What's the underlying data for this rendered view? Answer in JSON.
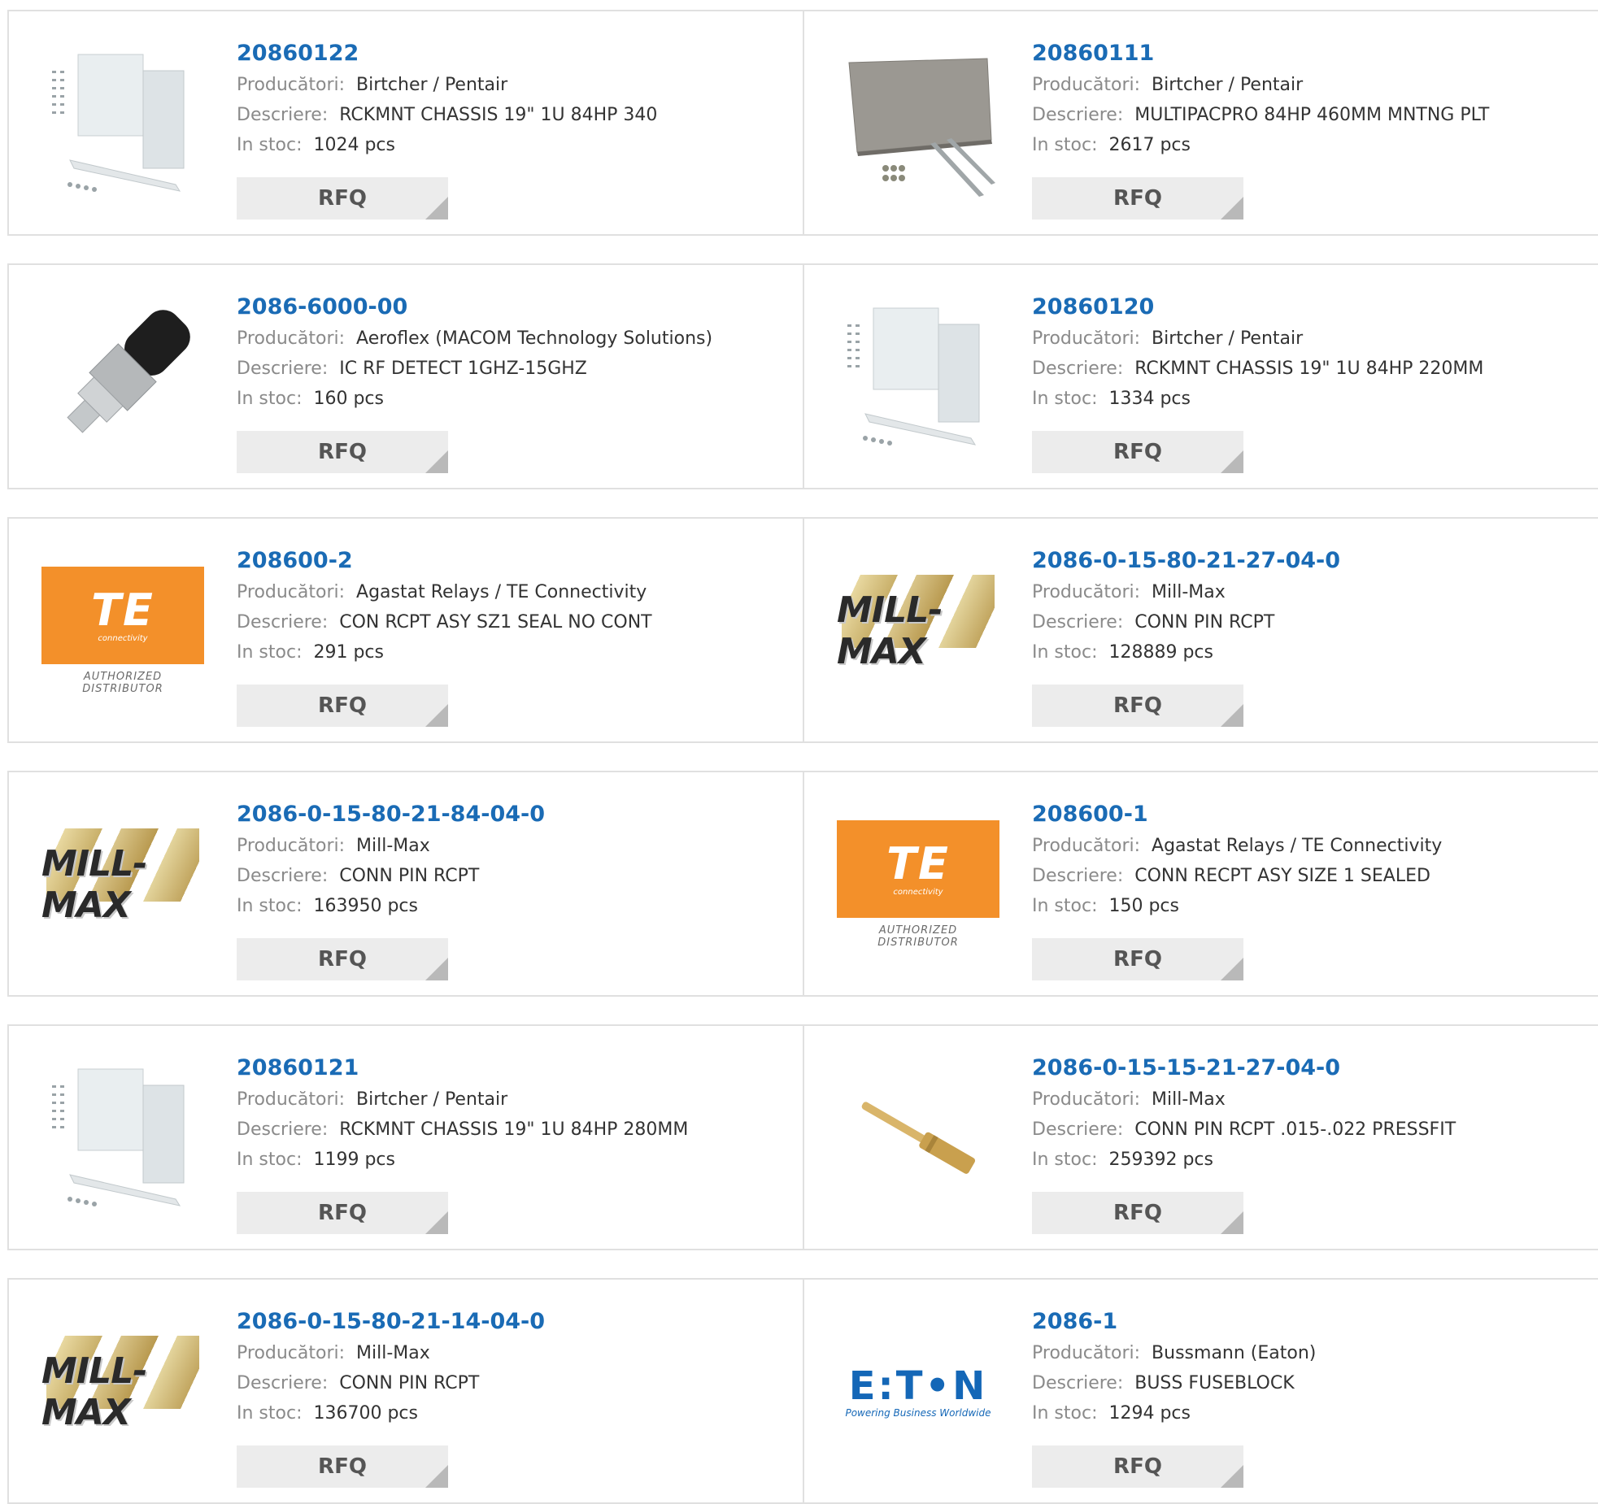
{
  "labels": {
    "manufacturer": "Producători:",
    "description": "Descriere:",
    "stock": "In stoc:",
    "rfq": "RFQ"
  },
  "products": [
    {
      "pn": "20860122",
      "mfr": "Birtcher / Pentair",
      "desc": "RCKMNT CHASSIS 19\" 1U 84HP 340",
      "stock": "1024 pcs",
      "image": "chassis-kit-image"
    },
    {
      "pn": "20860111",
      "mfr": "Birtcher / Pentair",
      "desc": "MULTIPACPRO 84HP 460MM MNTNG PLT",
      "stock": "2617 pcs",
      "image": "mounting-plate-image"
    },
    {
      "pn": "2086-6000-00",
      "mfr": "Aeroflex (MACOM Technology Solutions)",
      "desc": "IC RF DETECT 1GHZ-15GHZ",
      "stock": "160 pcs",
      "image": "rf-detector-image"
    },
    {
      "pn": "20860120",
      "mfr": "Birtcher / Pentair",
      "desc": "RCKMNT CHASSIS 19\" 1U 84HP 220MM",
      "stock": "1334 pcs",
      "image": "chassis-kit-image"
    },
    {
      "pn": "208600-2",
      "mfr": "Agastat Relays / TE Connectivity",
      "desc": "CON RCPT ASY SZ1 SEAL NO CONT",
      "stock": "291 pcs",
      "image": "te-connectivity-logo"
    },
    {
      "pn": "2086-0-15-80-21-27-04-0",
      "mfr": "Mill-Max",
      "desc": "CONN PIN RCPT",
      "stock": "128889 pcs",
      "image": "mill-max-logo"
    },
    {
      "pn": "2086-0-15-80-21-84-04-0",
      "mfr": "Mill-Max",
      "desc": "CONN PIN RCPT",
      "stock": "163950 pcs",
      "image": "mill-max-logo"
    },
    {
      "pn": "208600-1",
      "mfr": "Agastat Relays / TE Connectivity",
      "desc": "CONN RECPT ASY SIZE 1 SEALED",
      "stock": "150 pcs",
      "image": "te-connectivity-logo"
    },
    {
      "pn": "20860121",
      "mfr": "Birtcher / Pentair",
      "desc": "RCKMNT CHASSIS 19\" 1U 84HP 280MM",
      "stock": "1199 pcs",
      "image": "chassis-kit-image"
    },
    {
      "pn": "2086-0-15-15-21-27-04-0",
      "mfr": "Mill-Max",
      "desc": "CONN PIN RCPT .015-.022 PRESSFIT",
      "stock": "259392 pcs",
      "image": "pin-receptacle-image"
    },
    {
      "pn": "2086-0-15-80-21-14-04-0",
      "mfr": "Mill-Max",
      "desc": "CONN PIN RCPT",
      "stock": "136700 pcs",
      "image": "mill-max-logo"
    },
    {
      "pn": "2086-1",
      "mfr": "Bussmann (Eaton)",
      "desc": "BUSS FUSEBLOCK",
      "stock": "1294 pcs",
      "image": "eaton-logo"
    }
  ],
  "logos": {
    "te": {
      "mark": "TE",
      "sub": "connectivity",
      "auth": "AUTHORIZED DISTRIBUTOR"
    },
    "millmax": {
      "word": "MILL-MAX"
    },
    "eaton": {
      "word": "E:T•N",
      "sub": "Powering Business Worldwide"
    }
  },
  "colors": {
    "link": "#1a6bb5",
    "te_orange": "#f3902a",
    "eaton_blue": "#1467b7",
    "button_bg": "#ececec"
  }
}
